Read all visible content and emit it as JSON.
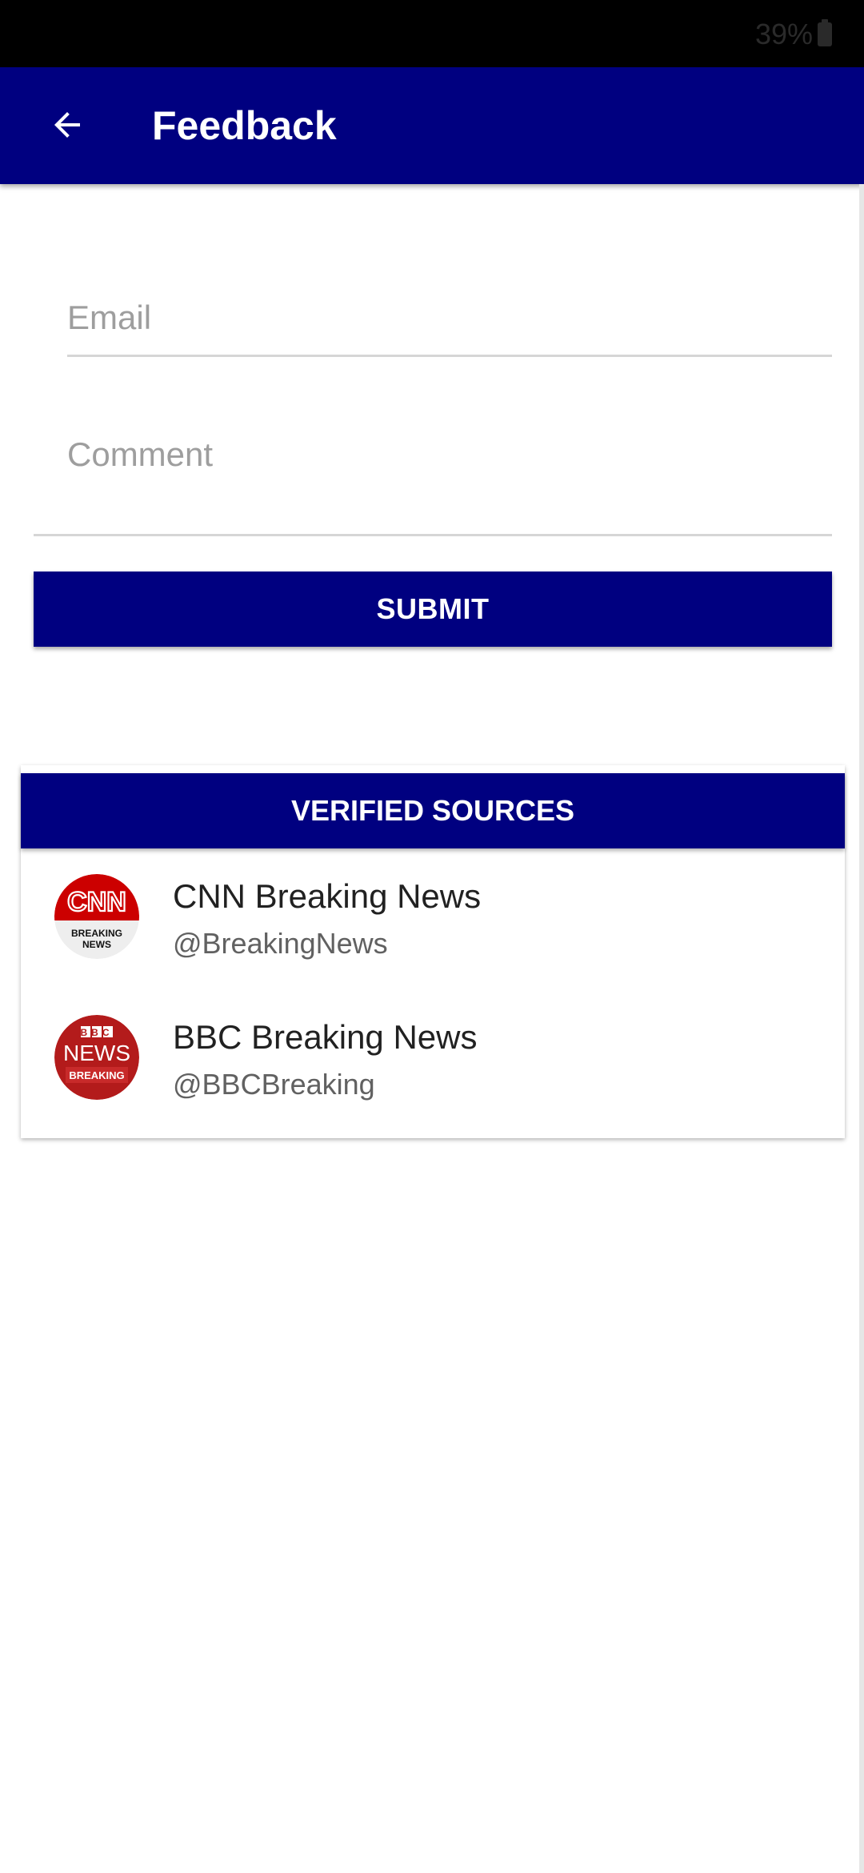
{
  "status_bar": {
    "battery_text": "39%"
  },
  "app_bar": {
    "title": "Feedback",
    "back_icon": "arrow-left-icon"
  },
  "form": {
    "email_placeholder": "Email",
    "comment_placeholder": "Comment",
    "submit_label": "SUBMIT"
  },
  "sources": {
    "header": "VERIFIED SOURCES",
    "items": [
      {
        "name": "CNN Breaking News",
        "handle": "@BreakingNews",
        "logo": {
          "mark": "CNN",
          "line1": "BREAKING",
          "line2": "NEWS"
        }
      },
      {
        "name": "BBC Breaking News",
        "handle": "@BBCBreaking",
        "logo": {
          "mark": "BBC",
          "line1": "NEWS",
          "line2": "BREAKING"
        }
      }
    ]
  },
  "colors": {
    "primary": "#000080",
    "status_bar": "#000000",
    "cnn_red": "#cc0000",
    "bbc_red": "#b31b1b"
  }
}
